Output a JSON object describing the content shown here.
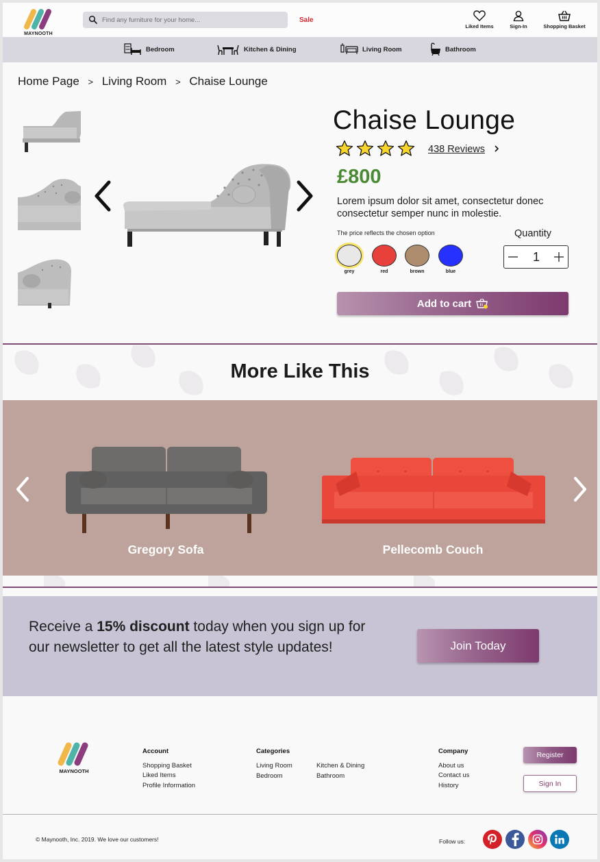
{
  "header": {
    "brand": "MAYNOOTH",
    "search_placeholder": "Find any furniture for your home...",
    "sale_label": "Sale",
    "liked_label": "Liked Items",
    "signin_label": "Sign-In",
    "basket_label": "Shopping Basket"
  },
  "categories": [
    {
      "label": "Bedroom",
      "icon": "bed-icon"
    },
    {
      "label": "Kitchen & Dining",
      "icon": "dining-table-icon"
    },
    {
      "label": "Living Room",
      "icon": "sofa-icon"
    },
    {
      "label": "Bathroom",
      "icon": "bathtub-icon"
    }
  ],
  "breadcrumb": [
    "Home Page",
    ">",
    "Living Room",
    ">",
    "Chaise Lounge"
  ],
  "product": {
    "title": "Chaise Lounge",
    "rating": 4,
    "reviews_label": "438 Reviews",
    "price": "£800",
    "description": "Lorem ipsum dolor sit amet, consectetur donec consectetur semper nunc in molestie.",
    "option_label": "The price reflects the chosen option",
    "colors": [
      {
        "name": "grey",
        "hex": "#e9e8e8",
        "selected": true
      },
      {
        "name": "red",
        "hex": "#e8403a",
        "selected": false
      },
      {
        "name": "brown",
        "hex": "#ad8d6e",
        "selected": false
      },
      {
        "name": "blue",
        "hex": "#2631ff",
        "selected": false
      }
    ],
    "quantity_label": "Quantity",
    "quantity": "1",
    "cart_label": "Add to cart"
  },
  "more": {
    "title": "More Like This",
    "items": [
      {
        "name": "Gregory Sofa",
        "color": "#6b6a68"
      },
      {
        "name": "Pellecomb Couch",
        "color": "#e84a3c"
      }
    ]
  },
  "newsletter": {
    "text_before": "Receive a ",
    "text_bold": "15% discount",
    "text_after": " today when you sign up for our newsletter to get all the latest style updates!",
    "button_label": "Join Today"
  },
  "footer": {
    "brand": "MAYNOOTH",
    "account_heading": "Account",
    "account_links": [
      "Shopping Basket",
      "Liked Items",
      "Profile Information"
    ],
    "categories_heading": "Categories",
    "categories_links": [
      "Living Room",
      "Kitchen & Dining",
      "Bedroom",
      "Bathroom"
    ],
    "company_heading": "Company",
    "company_links": [
      "About us",
      "Contact us",
      "History"
    ],
    "register_label": "Register",
    "signin_label": "Sign In",
    "copyright": "© Maynooth, Inc. 2019. We love our customers!",
    "follow_label": "Follow us:",
    "socials": [
      {
        "name": "pinterest-icon",
        "color": "#d42027"
      },
      {
        "name": "facebook-icon",
        "color": "#3b5998"
      },
      {
        "name": "instagram-icon",
        "color": "#c13584"
      },
      {
        "name": "linkedin-icon",
        "color": "#0a77b5"
      }
    ]
  },
  "colors": {
    "accent": "#7d3a6e",
    "price_green": "#4a8a32",
    "sale_red": "#d0282e",
    "nav_bg": "#d8d6df",
    "carousel_bg": "#bea39c",
    "newsletter_bg": "#c8c4d5"
  }
}
